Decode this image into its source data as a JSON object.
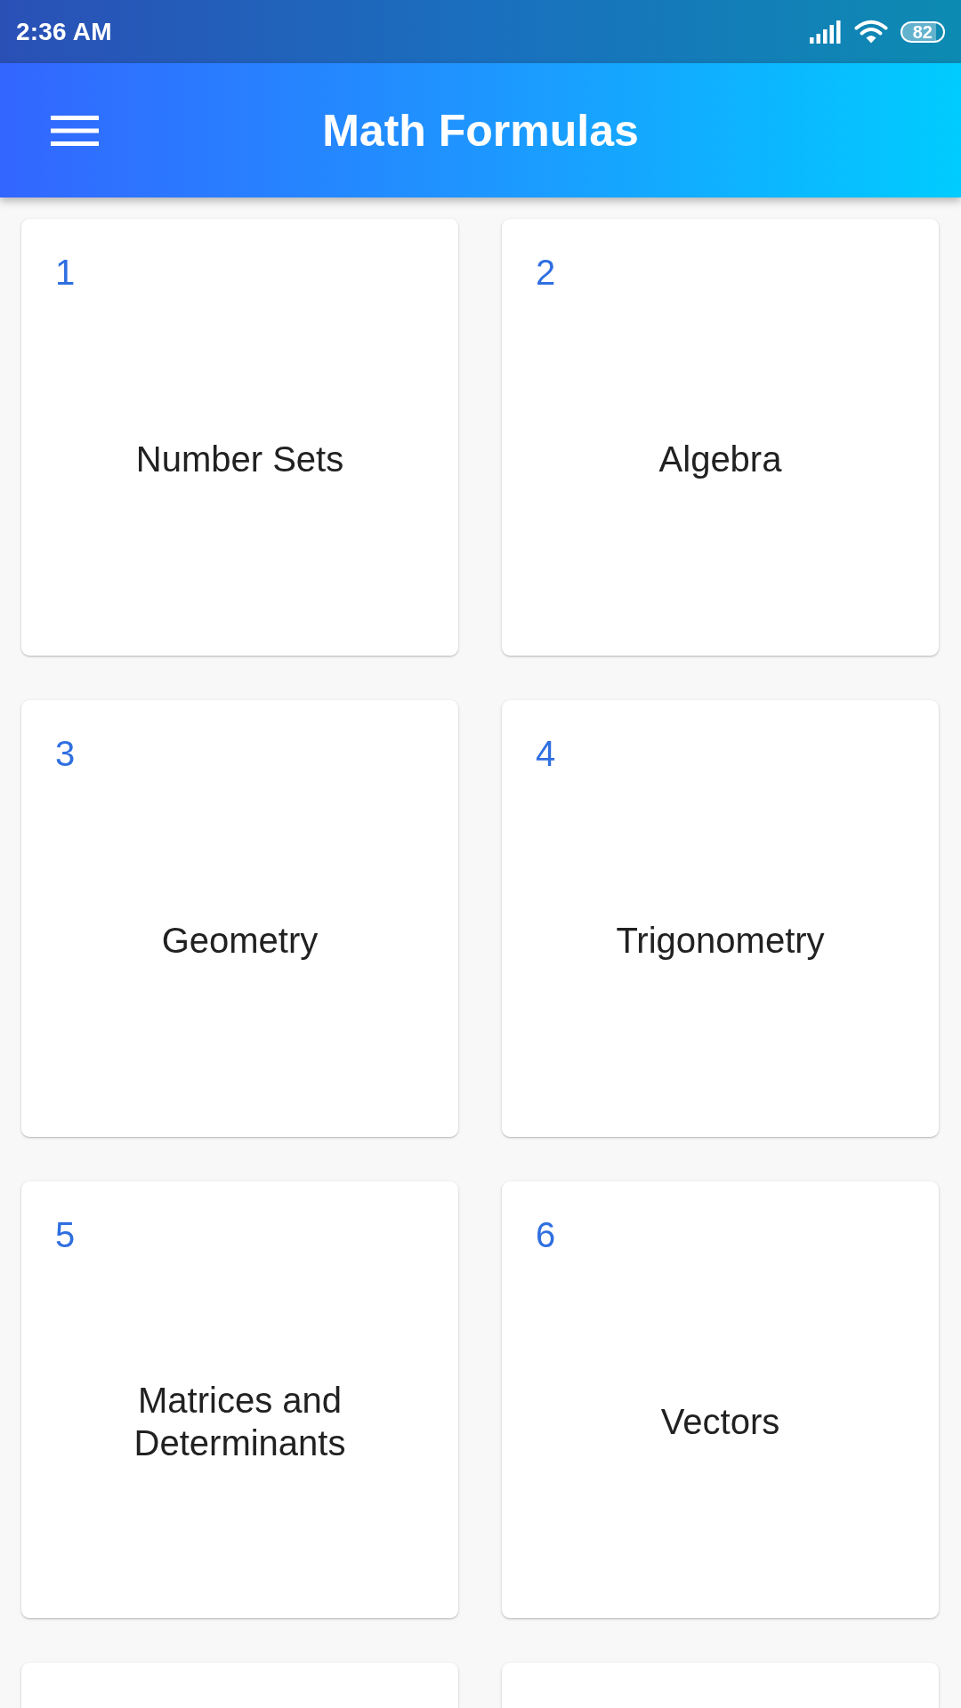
{
  "status_bar": {
    "time": "2:36 AM",
    "battery": "82"
  },
  "app_bar": {
    "title": "Math Formulas"
  },
  "topics": [
    {
      "kind": "topic",
      "number": "1",
      "title": "Number Sets"
    },
    {
      "kind": "topic",
      "number": "2",
      "title": "Algebra"
    },
    {
      "kind": "topic",
      "number": "3",
      "title": "Geometry"
    },
    {
      "kind": "topic",
      "number": "4",
      "title": "Trigonometry"
    },
    {
      "kind": "topic",
      "number": "5",
      "title": "Matrices and Determinants"
    },
    {
      "kind": "topic",
      "number": "6",
      "title": "Vectors"
    },
    {
      "kind": "partial"
    },
    {
      "kind": "partial"
    }
  ]
}
